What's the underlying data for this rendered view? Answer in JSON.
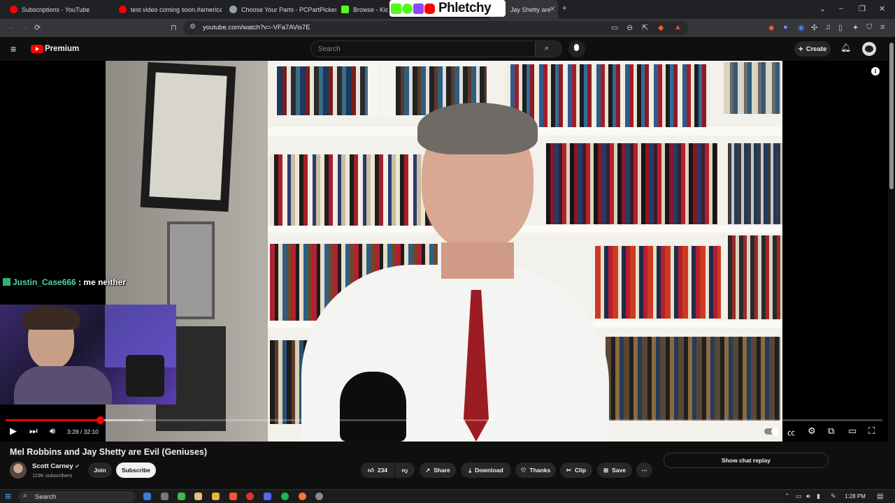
{
  "browser": {
    "tabs": [
      {
        "title": "Subscriptions - YouTube",
        "color": "#ff0000"
      },
      {
        "title": "test video coming soon.#america #",
        "color": "#ff0000"
      },
      {
        "title": "Choose Your Parts - PCPartPicker",
        "color": "#9aa0a6"
      },
      {
        "title": "Browse - Kick",
        "color": "#53fc18"
      },
      {
        "title": "Jay Shetty are",
        "color": "#ff0000"
      }
    ],
    "url": "youtube.com/watch?v=-VFa7AVis7E"
  },
  "overlay": {
    "name": "Phletchy",
    "box_colors": [
      "#53fc18",
      "#53fc18",
      "#9146ff",
      "#ff0000"
    ]
  },
  "youtube": {
    "logo_text": "Premium",
    "search_placeholder": "Search",
    "create_label": "Create"
  },
  "player": {
    "chat_user": "Justin_Case666",
    "chat_message": " : me neither",
    "time_current": "3:28",
    "time_total": "32:10",
    "progress_fraction": 0.108,
    "buffer_fraction": 0.157
  },
  "video": {
    "title": "Mel Robbins and Jay Shetty are Evil (Geniuses)",
    "channel": "Scott Carney",
    "subscribers": "119K subscribers",
    "join_label": "Join",
    "subscribe_label": "Subscribe",
    "like_count": "234",
    "share_label": "Share",
    "download_label": "Download",
    "thanks_label": "Thanks",
    "clip_label": "Clip",
    "save_label": "Save",
    "chat_replay_label": "Show chat replay"
  },
  "taskbar": {
    "search_label": "Search",
    "clock": "1:28 PM"
  }
}
